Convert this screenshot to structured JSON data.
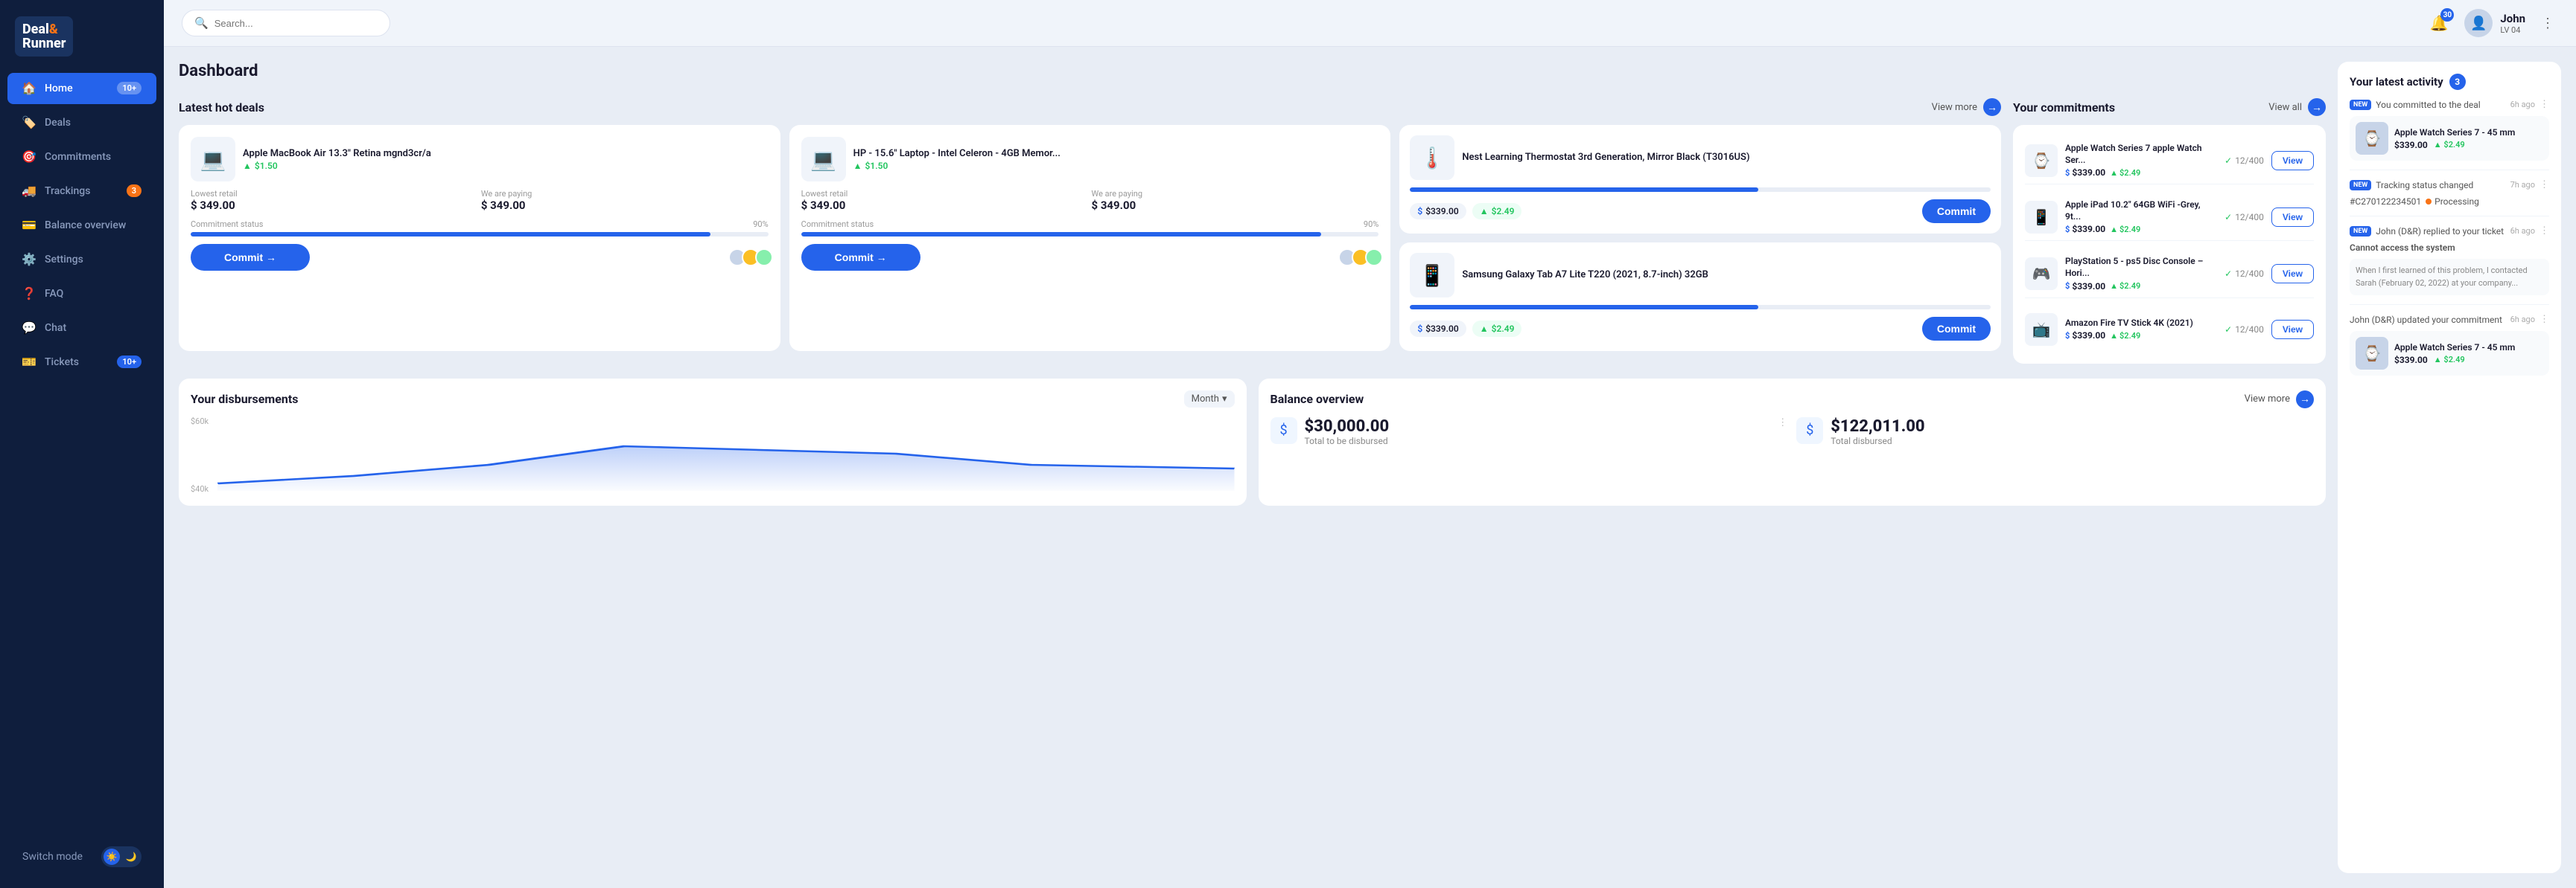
{
  "sidebar": {
    "logo": {
      "deal": "Deal",
      "amp": "&",
      "runner": "Runner"
    },
    "nav": [
      {
        "id": "home",
        "label": "Home",
        "icon": "🏠",
        "badge": "10+",
        "active": true
      },
      {
        "id": "deals",
        "label": "Deals",
        "icon": "🏷️",
        "badge": ""
      },
      {
        "id": "commitments",
        "label": "Commitments",
        "icon": "🎯",
        "badge": ""
      },
      {
        "id": "trackings",
        "label": "Trackings",
        "icon": "🚚",
        "badge": "3"
      },
      {
        "id": "balance",
        "label": "Balance overview",
        "icon": "💳",
        "badge": ""
      },
      {
        "id": "settings",
        "label": "Settings",
        "icon": "⚙️",
        "badge": ""
      },
      {
        "id": "faq",
        "label": "FAQ",
        "icon": "❓",
        "badge": ""
      },
      {
        "id": "chat",
        "label": "Chat",
        "icon": "💬",
        "badge": ""
      },
      {
        "id": "tickets",
        "label": "Tickets",
        "icon": "🎫",
        "badge": "10+"
      }
    ],
    "switch_mode": "Switch mode"
  },
  "header": {
    "search_placeholder": "Search...",
    "notifications_count": "30",
    "user": {
      "name": "John",
      "level": "LV 04",
      "avatar_emoji": "👤"
    }
  },
  "page": {
    "title": "Dashboard"
  },
  "hot_deals": {
    "section_title": "Latest hot deals",
    "view_more": "View more",
    "deals": [
      {
        "id": "deal1",
        "title": "Apple MacBook Air 13.3\" Retina mgnd3cr/a",
        "img_emoji": "💻",
        "savings": "$1.50",
        "lowest_retail_label": "Lowest retail",
        "lowest_retail_price": "$ 349.00",
        "we_paying_label": "We are paying",
        "we_paying_price": "$ 349.00",
        "commitment_status_label": "Commitment status",
        "progress_pct": 90,
        "progress_label": "90%",
        "commit_label": "Commit →"
      },
      {
        "id": "deal2",
        "title": "HP - 15.6\" Laptop - Intel Celeron - 4GB Memor...",
        "img_emoji": "💻",
        "savings": "$1.50",
        "lowest_retail_label": "Lowest retail",
        "lowest_retail_price": "$ 349.00",
        "we_paying_label": "We are paying",
        "we_paying_price": "$ 349.00",
        "commitment_status_label": "Commitment status",
        "progress_pct": 90,
        "progress_label": "90%",
        "commit_label": "Commit →"
      },
      {
        "id": "deal3_nest1",
        "title": "Nest Learning Thermostat 3rd Generation, Mirror Black (T3016US)",
        "img_emoji": "🌡️",
        "price": "$339.00",
        "savings": "$2.49",
        "progress_pct": 60,
        "progress_label": "60%",
        "commit_label": "Commit"
      },
      {
        "id": "deal3_nest2",
        "title": "Samsung Galaxy Tab A7 Lite T220 (2021, 8.7-inch) 32GB",
        "img_emoji": "📱",
        "price": "$339.00",
        "savings": "$2.49",
        "progress_pct": 60,
        "progress_label": "60%",
        "commit_label": "Commit"
      }
    ]
  },
  "commitments": {
    "section_title": "Your commitments",
    "view_all": "View all",
    "items": [
      {
        "name": "Apple Watch Series 7 apple Watch Ser...",
        "img_emoji": "⌚",
        "price": "$339.00",
        "savings": "$2.49",
        "count": "12/400",
        "view_label": "View"
      },
      {
        "name": "Apple iPad 10.2\" 64GB WiFi -Grey, 9t...",
        "img_emoji": "📱",
        "price": "$339.00",
        "savings": "$2.49",
        "count": "12/400",
        "view_label": "View"
      },
      {
        "name": "PlayStation 5 - ps5 Disc Console – Hori...",
        "img_emoji": "🎮",
        "price": "$339.00",
        "savings": "$2.49",
        "count": "12/400",
        "view_label": "View"
      },
      {
        "name": "Amazon Fire TV Stick 4K (2021)",
        "img_emoji": "📺",
        "price": "$339.00",
        "savings": "$2.49",
        "count": "12/400",
        "view_label": "View"
      }
    ]
  },
  "disbursements": {
    "section_title": "Your disbursements",
    "month_label": "Month",
    "chart_labels": [
      "$60k",
      "$40k"
    ],
    "chart_data": [
      20,
      35,
      55,
      80,
      70,
      60,
      40
    ]
  },
  "balance_overview": {
    "section_title": "Balance overview",
    "view_more": "View more",
    "total_disbursed_label": "Total to be disbursed",
    "total_disbursed_amount": "$30,000.00",
    "total_disbursed2_label": "Total disbursed",
    "total_disbursed2_amount": "$122,011.00"
  },
  "activity": {
    "section_title": "Your latest activity",
    "count": "3",
    "items": [
      {
        "type": "commit",
        "is_new": true,
        "description": "You committed to the deal",
        "time": "6h ago",
        "product_name": "Apple Watch Series 7 - 45 mm",
        "product_img_emoji": "⌚",
        "price": "$339.00",
        "savings": "$2.49"
      },
      {
        "type": "tracking",
        "is_new": true,
        "description": "Tracking status changed",
        "time": "7h ago",
        "tracking_id": "#C270122234501",
        "tracking_status": "Processing"
      },
      {
        "type": "reply",
        "is_new": true,
        "description": "John (D&R) replied to your ticket",
        "time": "6h ago",
        "ticket_subject": "Cannot access the system",
        "ticket_body": "When I first learned of this problem, I contacted Sarah (February 02, 2022) at your company..."
      },
      {
        "type": "update",
        "is_new": false,
        "description": "John (D&R) updated your commitment",
        "time": "6h ago",
        "product_name": "Apple Watch Series 7 - 45 mm",
        "product_img_emoji": "⌚",
        "price": "$339.00",
        "savings": "$2.49"
      }
    ]
  }
}
